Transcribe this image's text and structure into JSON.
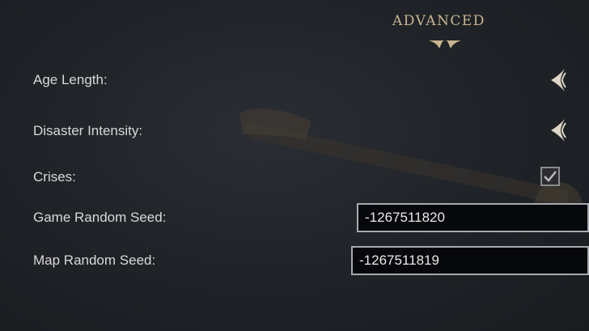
{
  "section": {
    "title": "ADVANCED"
  },
  "settings": {
    "age_length": {
      "label": "Age Length:",
      "control_icon": "chevron-left-icon"
    },
    "disaster_intensity": {
      "label": "Disaster Intensity:",
      "control_icon": "chevron-left-icon"
    },
    "crises": {
      "label": "Crises:",
      "checked": true
    },
    "game_random_seed": {
      "label": "Game Random Seed:",
      "value": "-1267511820"
    },
    "map_random_seed": {
      "label": "Map Random Seed:",
      "value": "-1267511819"
    }
  },
  "colors": {
    "background": "#1f2227",
    "gold_accent": "#c9b68e",
    "label_text": "#d8d8d6",
    "input_border": "#a7aab0",
    "input_background": "#07080b"
  }
}
